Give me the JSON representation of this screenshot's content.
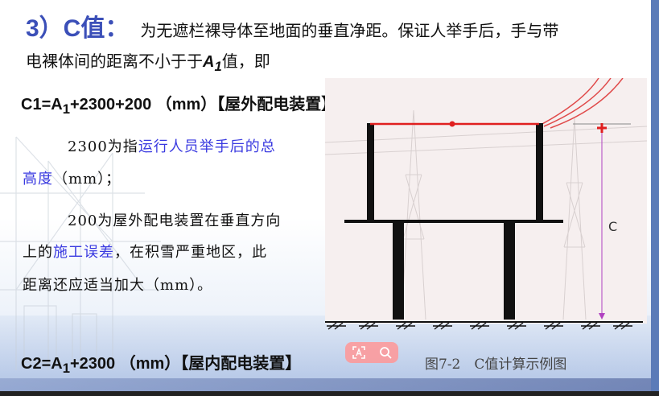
{
  "heading": {
    "number": "3）C值：",
    "description": "为无遮栏裸导体至地面的垂直净距。保证人举手后，手与带"
  },
  "line2": {
    "before": "电裸体间的距离不小于于",
    "var": "A",
    "sub": "1",
    "after": "值，即"
  },
  "formula1": {
    "prefix": "C1=A",
    "sub": "1",
    "rest": "+2300+200 （mm）",
    "tag": "【屋外配电装置】"
  },
  "para1": {
    "line1_plain": "2300为指",
    "line1_hl": "运行人员举手后的总",
    "line2_hl": "高度",
    "line2_plain": "（mm）；"
  },
  "para2": {
    "line1": "200为屋外配电装置在垂直方向",
    "line2_plain_a": "上的",
    "line2_hl": "施工误差",
    "line2_plain_b": "，在积雪严重地区，此",
    "line3": "距离还应适当加大（mm）。"
  },
  "formula2": {
    "prefix": "C2=A",
    "sub": "1",
    "rest": "+2300 （mm）",
    "tag": "【屋内配电装置】"
  },
  "figure": {
    "dimension_label": "C",
    "caption": "图7-2　C值计算示例图"
  },
  "overlay": {
    "icons": [
      "text-recognize-icon",
      "magnifier-icon"
    ]
  },
  "colors": {
    "heading": "#3b4fb8",
    "highlight": "#3a3ae0",
    "conductor": "#e02020",
    "dimension": "#b040c0"
  }
}
